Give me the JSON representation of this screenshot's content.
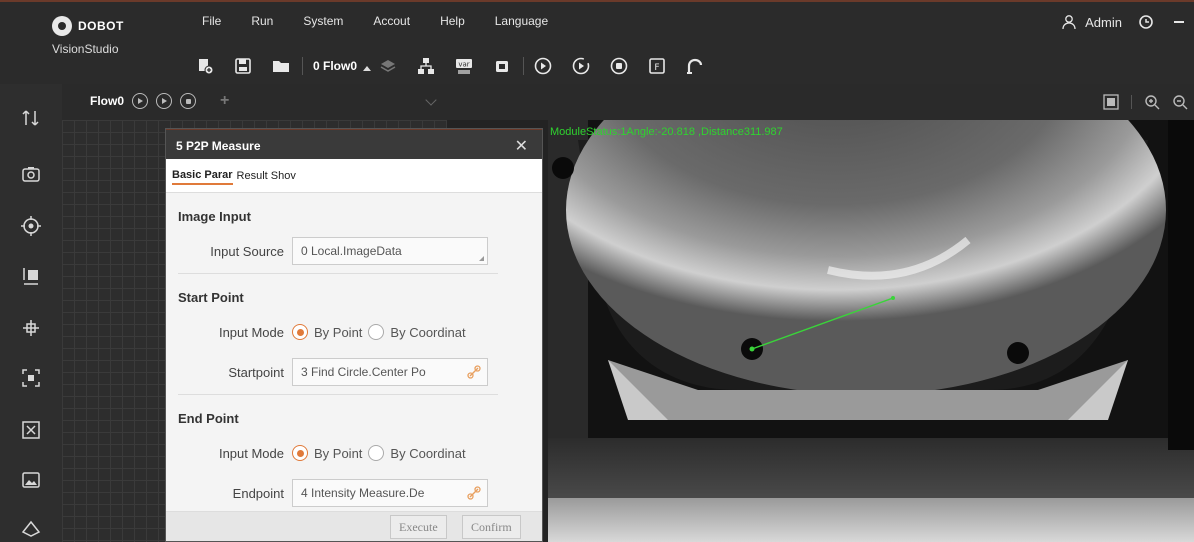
{
  "brand": {
    "company": "DOBOT",
    "product": "VisionStudio"
  },
  "menu": [
    "File",
    "Run",
    "System",
    "Accout",
    "Help",
    "Language"
  ],
  "toolbar": {
    "flow_select": "0 Flow0"
  },
  "user": {
    "name": "Admin"
  },
  "flow": {
    "tab_label": "Flow0"
  },
  "image_view": {
    "status": "ModuleStatus:1Angle:-20.818 ,Distance311.987"
  },
  "dialog": {
    "title": "5 P2P Measure",
    "tabs": [
      "Basic Parar",
      "Result Shov"
    ],
    "image_input": {
      "section": "Image Input",
      "input_source_label": "Input Source",
      "input_source_value": "0 Local.ImageData"
    },
    "start_point": {
      "section": "Start Point",
      "input_mode_label": "Input Mode",
      "option_point": "By Point",
      "option_coord": "By Coordinat",
      "point_label": "Startpoint",
      "point_value": "3 Find Circle.Center Po"
    },
    "end_point": {
      "section": "End Point",
      "input_mode_label": "Input Mode",
      "option_point": "By Point",
      "option_coord": "By Coordinat",
      "point_label": "Endpoint",
      "point_value": "4 Intensity Measure.De"
    },
    "buttons": {
      "execute": "Execute",
      "confirm": "Confirm"
    }
  },
  "colors": {
    "accent": "#e07a3a",
    "status_text": "#2fd32f",
    "topbar": "#2b2b2b"
  },
  "icons": [
    "import-icon",
    "save-icon",
    "open-folder-icon",
    "layers-icon",
    "network-icon",
    "var-icon",
    "camera-settings-icon",
    "run-once-icon",
    "run-loop-icon",
    "stop-icon",
    "f-module-icon",
    "robot-arm-icon",
    "user-icon",
    "clock-icon"
  ]
}
